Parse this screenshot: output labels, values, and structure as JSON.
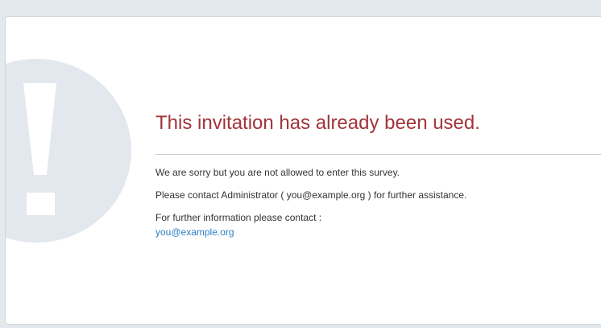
{
  "message": {
    "title": "This invitation has already been used.",
    "line_not_allowed": "We are sorry but you are not allowed to enter this survey.",
    "line_contact": "Please contact Administrator ( you@example.org ) for further assistance.",
    "line_further_info": "For further information please contact :",
    "contact_email": "you@example.org"
  },
  "colors": {
    "title": "#a1343a",
    "link": "#2a7ec6",
    "icon_circle": "#e2e8ed",
    "page_background": "#e4e9ee"
  },
  "icons": {
    "warning": "exclamation-circle-icon"
  }
}
